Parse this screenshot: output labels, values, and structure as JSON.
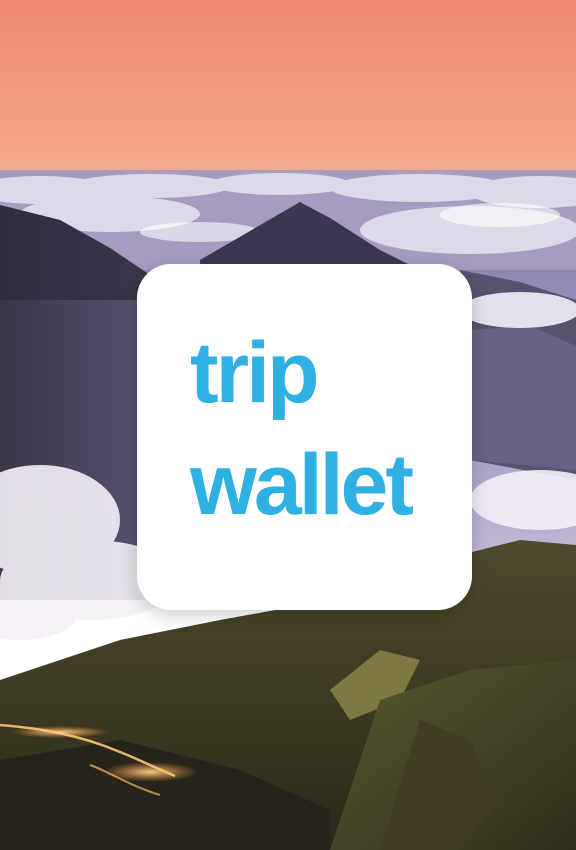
{
  "app": {
    "logo": {
      "line1": "trip",
      "line2": "wallet"
    }
  },
  "colors": {
    "brand": "#2eb0e2",
    "card": "#ffffff",
    "sky_top": "#f08a70",
    "sky_horizon": "#f7a88a",
    "mist": "#b7adcf",
    "mountain_dark": "#2b2a3a",
    "slope_green": "#5b5a2c"
  },
  "background": {
    "scene": "mountain-sunrise-sea-of-clouds"
  }
}
